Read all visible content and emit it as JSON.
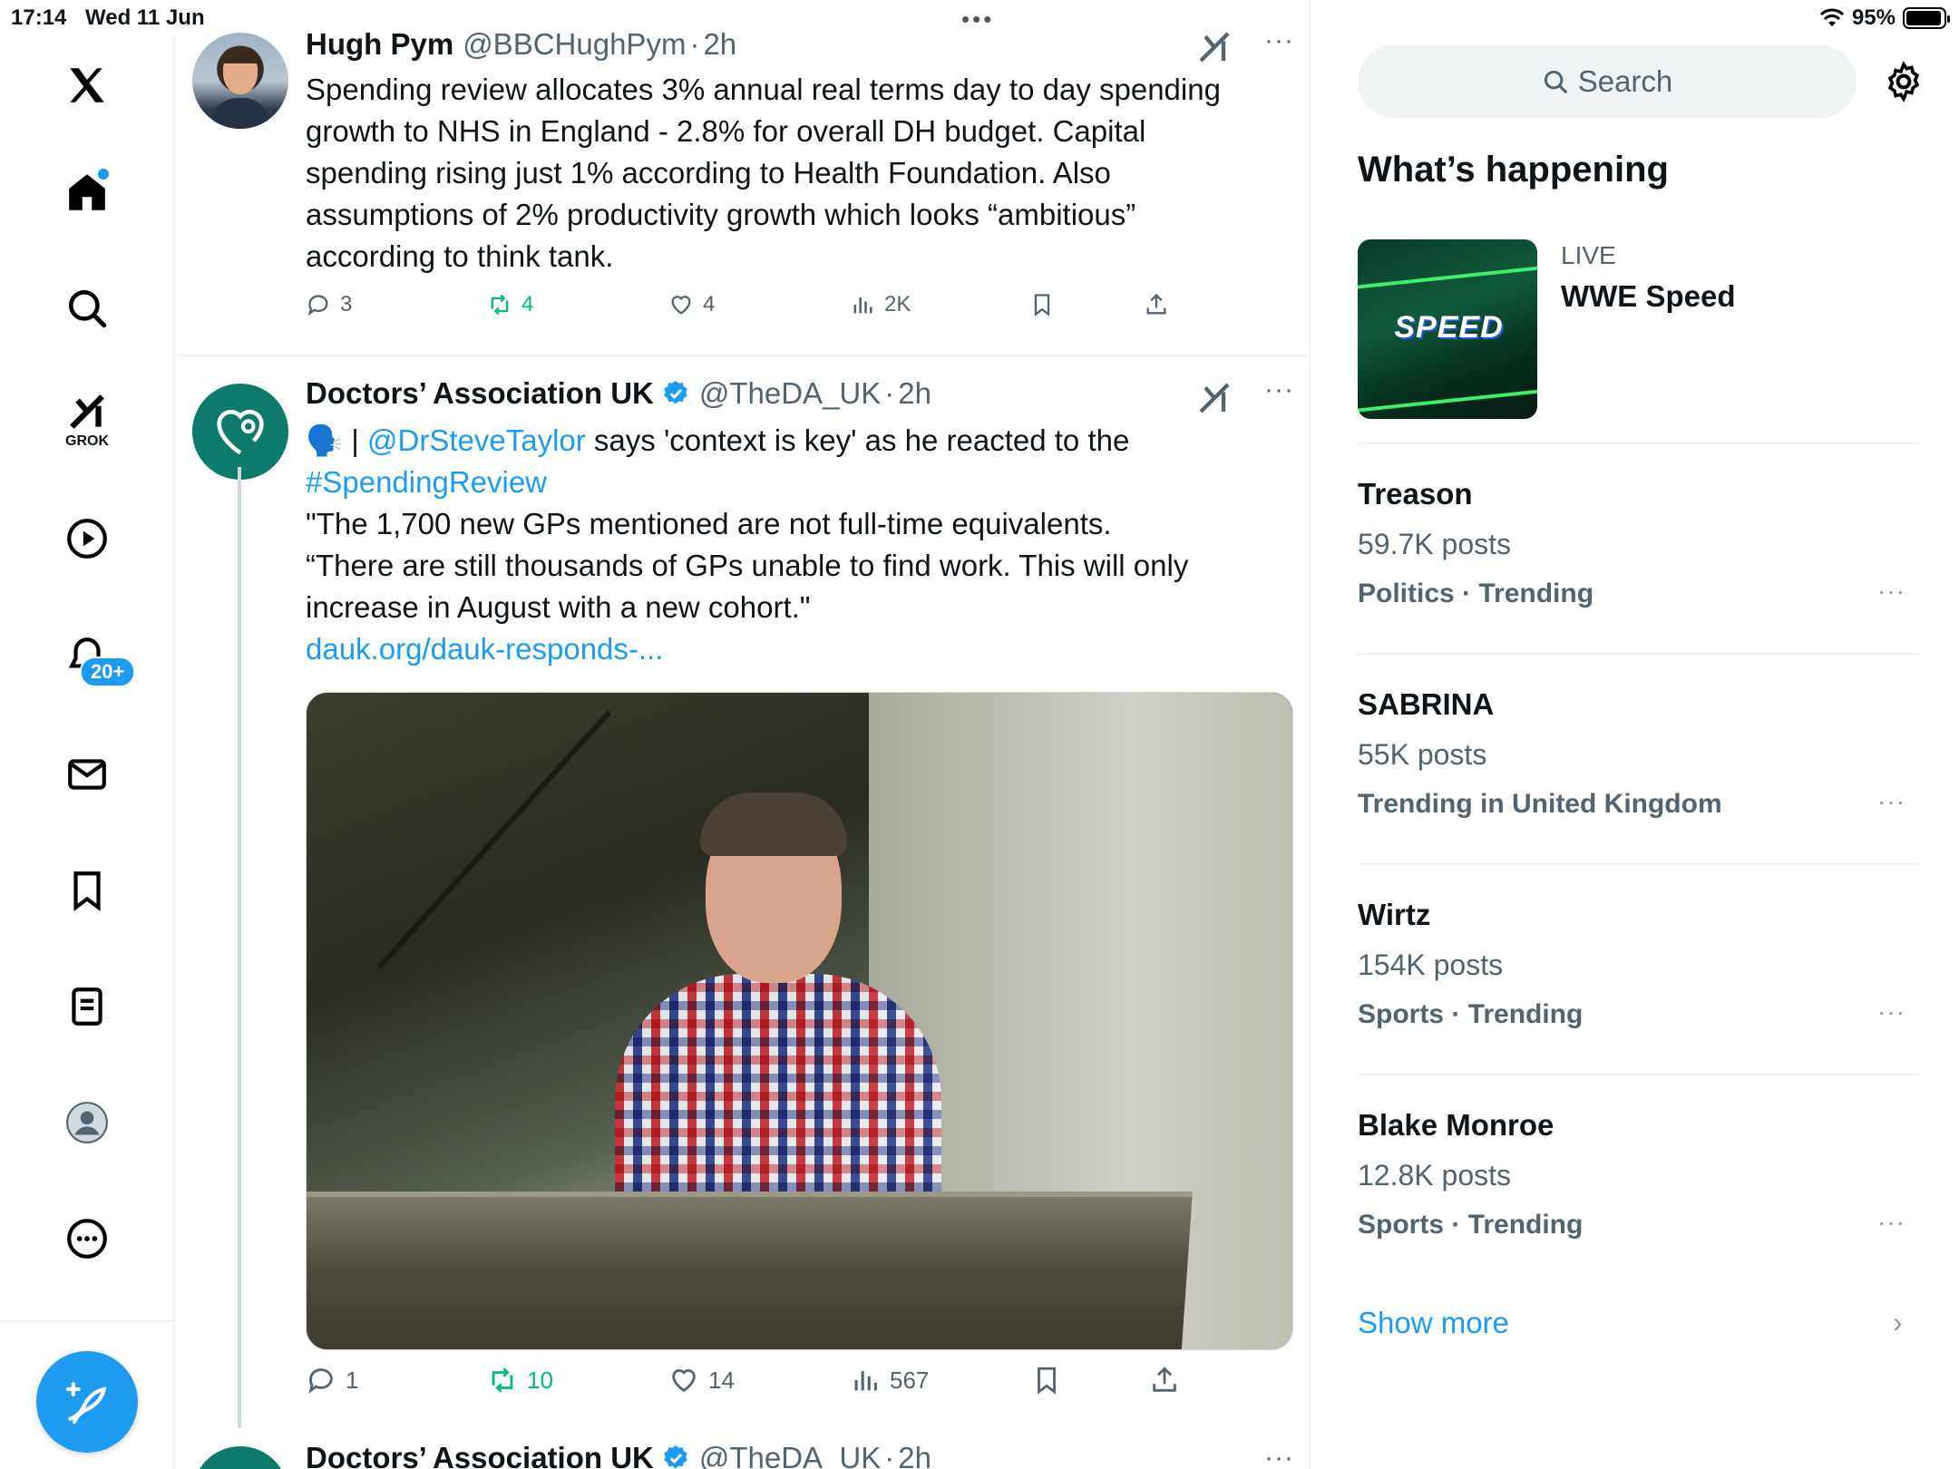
{
  "status_bar": {
    "time": "17:14",
    "date": "Wed 11 Jun",
    "battery": "95%",
    "battery_level": 0.95
  },
  "nav": {
    "grok_label": "GROK",
    "notifications_badge": "20+",
    "items": [
      "x-logo",
      "home",
      "explore",
      "grok",
      "video",
      "notifications",
      "messages",
      "bookmarks",
      "lists",
      "profile",
      "more"
    ]
  },
  "feed": {
    "tweets": [
      {
        "name": "Hugh Pym",
        "handle": "@BBCHughPym",
        "time": "2h",
        "text": "Spending review allocates 3% annual real terms day to day spending growth to NHS in England - 2.8% for overall DH budget. Capital spending rising just 1% according to Health Foundation. Also assumptions of 2% productivity growth which looks “ambitious” according to think tank.",
        "replies": "3",
        "reposts": "4",
        "likes": "4",
        "views": "2K"
      },
      {
        "name": "Doctors’ Association UK",
        "handle": "@TheDA_UK",
        "time": "2h",
        "emoji": "🗣️",
        "separator": "|",
        "mention": "@DrSteveTaylor",
        "text_after_mention": "says 'context is key' as he reacted to the",
        "hashtag": "#SpendingReview",
        "quote_line1": "\"The 1,700 new GPs mentioned are not full-time equivalents.",
        "quote_line2": "“There are still thousands of GPs unable to find work. This will only increase in August with a new cohort.\"",
        "url": "dauk.org/dauk-responds-...",
        "replies": "1",
        "reposts": "10",
        "likes": "14",
        "views": "567"
      },
      {
        "name": "Doctors’ Association UK",
        "handle": "@TheDA_UK",
        "time": "2h"
      }
    ]
  },
  "sidebar": {
    "search_placeholder": "Search",
    "whats_happening": "What’s happening",
    "live": {
      "label": "LIVE",
      "title": "WWE Speed",
      "image_text": "SPEED"
    },
    "trends": [
      {
        "name": "Treason",
        "posts": "59.7K posts",
        "category": "Politics · Trending"
      },
      {
        "name": "SABRINA",
        "posts": "55K posts",
        "category": "Trending in United Kingdom"
      },
      {
        "name": "Wirtz",
        "posts": "154K posts",
        "category": "Sports · Trending"
      },
      {
        "name": "Blake Monroe",
        "posts": "12.8K posts",
        "category": "Sports · Trending"
      }
    ],
    "show_more": "Show more"
  },
  "colors": {
    "accent": "#1d9bf0",
    "repost_green": "#00ba7c",
    "secondary_text": "#536471",
    "dauk_teal": "#0e7a6b"
  }
}
